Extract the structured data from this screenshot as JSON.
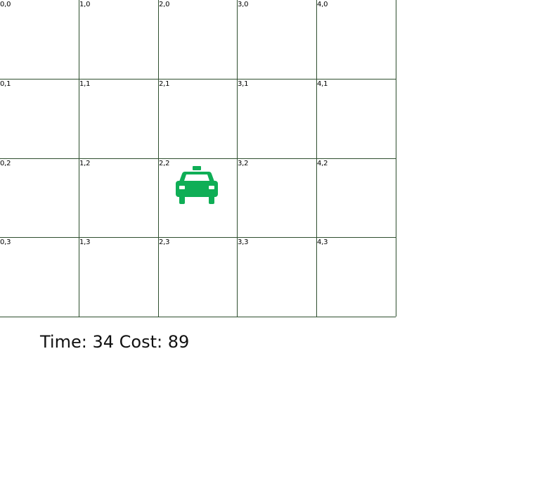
{
  "grid": {
    "rows": [
      [
        "0,0",
        "1,0",
        "2,0",
        "3,0",
        "4,0"
      ],
      [
        "0,1",
        "1,1",
        "2,1",
        "3,1",
        "4,1"
      ],
      [
        "0,2",
        "1,2",
        "2,2",
        "3,2",
        "4,2"
      ],
      [
        "0,3",
        "1,3",
        "2,3",
        "3,3",
        "4,3"
      ]
    ]
  },
  "taxi": {
    "icon": "taxi-icon",
    "color": "#0fae56",
    "cell": "2,2"
  },
  "status": {
    "time_label": "Time:",
    "time_value": "34",
    "cost_label": "Cost:",
    "cost_value": "89"
  }
}
